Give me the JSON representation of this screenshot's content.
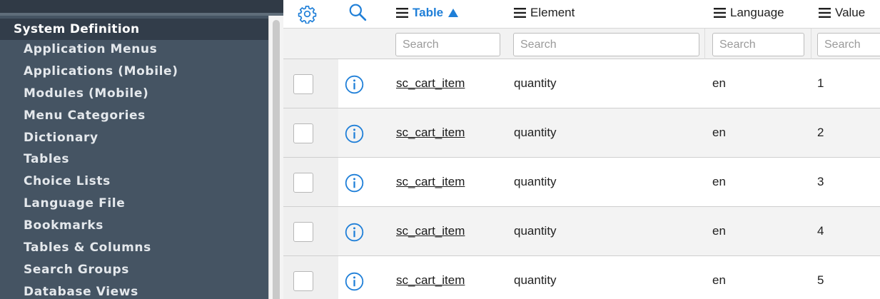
{
  "sidebar": {
    "section_title": "System Definition",
    "items": [
      {
        "label": "Application Menus"
      },
      {
        "label": "Applications (Mobile)"
      },
      {
        "label": "Modules (Mobile)"
      },
      {
        "label": "Menu Categories"
      },
      {
        "label": "Dictionary"
      },
      {
        "label": "Tables"
      },
      {
        "label": "Choice Lists"
      },
      {
        "label": "Language File"
      },
      {
        "label": "Bookmarks"
      },
      {
        "label": "Tables & Columns"
      },
      {
        "label": "Search Groups"
      },
      {
        "label": "Database Views"
      }
    ]
  },
  "list": {
    "columns": [
      {
        "label": "Table",
        "sorted": "ascending"
      },
      {
        "label": "Element"
      },
      {
        "label": "Language"
      },
      {
        "label": "Value"
      }
    ],
    "search_placeholder": "Search",
    "rows": [
      {
        "table": "sc_cart_item",
        "element": "quantity",
        "language": "en",
        "value": "1"
      },
      {
        "table": "sc_cart_item",
        "element": "quantity",
        "language": "en",
        "value": "2"
      },
      {
        "table": "sc_cart_item",
        "element": "quantity",
        "language": "en",
        "value": "3"
      },
      {
        "table": "sc_cart_item",
        "element": "quantity",
        "language": "en",
        "value": "4"
      },
      {
        "table": "sc_cart_item",
        "element": "quantity",
        "language": "en",
        "value": "5"
      }
    ]
  },
  "icons": {
    "settings": "gear-icon",
    "search": "search-icon",
    "row_info": "info-icon",
    "column_menu": "menu-icon",
    "sort": "sort-ascending-icon"
  },
  "colors": {
    "accent": "#1f7fd8",
    "sidebar_bg": "#455463",
    "sidebar_header_bg": "#323d4a"
  }
}
